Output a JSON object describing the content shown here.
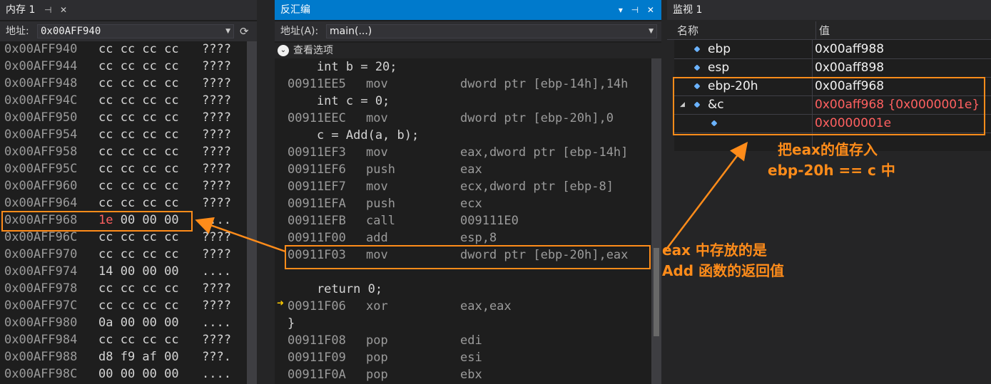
{
  "memory": {
    "title": "内存 1",
    "address_label": "地址:",
    "address_value": "0x00AFF940",
    "rows": [
      {
        "addr": "0x00AFF940",
        "bytes": "cc cc cc cc",
        "ascii": "????"
      },
      {
        "addr": "0x00AFF944",
        "bytes": "cc cc cc cc",
        "ascii": "????"
      },
      {
        "addr": "0x00AFF948",
        "bytes": "cc cc cc cc",
        "ascii": "????"
      },
      {
        "addr": "0x00AFF94C",
        "bytes": "cc cc cc cc",
        "ascii": "????"
      },
      {
        "addr": "0x00AFF950",
        "bytes": "cc cc cc cc",
        "ascii": "????"
      },
      {
        "addr": "0x00AFF954",
        "bytes": "cc cc cc cc",
        "ascii": "????"
      },
      {
        "addr": "0x00AFF958",
        "bytes": "cc cc cc cc",
        "ascii": "????"
      },
      {
        "addr": "0x00AFF95C",
        "bytes": "cc cc cc cc",
        "ascii": "????"
      },
      {
        "addr": "0x00AFF960",
        "bytes": "cc cc cc cc",
        "ascii": "????"
      },
      {
        "addr": "0x00AFF964",
        "bytes": "cc cc cc cc",
        "ascii": "????"
      },
      {
        "addr": "0x00AFF968",
        "bytes_hl": "1e",
        "bytes_rest": " 00 00 00",
        "ascii": "...."
      },
      {
        "addr": "0x00AFF96C",
        "bytes": "cc cc cc cc",
        "ascii": "????"
      },
      {
        "addr": "0x00AFF970",
        "bytes": "cc cc cc cc",
        "ascii": "????"
      },
      {
        "addr": "0x00AFF974",
        "bytes": "14 00 00 00",
        "ascii": "...."
      },
      {
        "addr": "0x00AFF978",
        "bytes": "cc cc cc cc",
        "ascii": "????"
      },
      {
        "addr": "0x00AFF97C",
        "bytes": "cc cc cc cc",
        "ascii": "????"
      },
      {
        "addr": "0x00AFF980",
        "bytes": "0a 00 00 00",
        "ascii": "...."
      },
      {
        "addr": "0x00AFF984",
        "bytes": "cc cc cc cc",
        "ascii": "????"
      },
      {
        "addr": "0x00AFF988",
        "bytes": "d8 f9 af 00",
        "ascii": "???."
      },
      {
        "addr": "0x00AFF98C",
        "bytes": "00 00 00 00",
        "ascii": "...."
      }
    ]
  },
  "disasm": {
    "title": "反汇编",
    "address_label": "地址(A):",
    "address_value": "main(...)",
    "options_label": "查看选项",
    "lines": [
      {
        "src": "    int b = 20;"
      },
      {
        "addr": "00911EE5",
        "op": "mov",
        "arg": "dword ptr [ebp-14h],14h"
      },
      {
        "src": "    int c = 0;"
      },
      {
        "addr": "00911EEC",
        "op": "mov",
        "arg": "dword ptr [ebp-20h],0"
      },
      {
        "src": "    c = Add(a, b);"
      },
      {
        "addr": "00911EF3",
        "op": "mov",
        "arg": "eax,dword ptr [ebp-14h]"
      },
      {
        "addr": "00911EF6",
        "op": "push",
        "arg": "eax"
      },
      {
        "addr": "00911EF7",
        "op": "mov",
        "arg": "ecx,dword ptr [ebp-8]"
      },
      {
        "addr": "00911EFA",
        "op": "push",
        "arg": "ecx"
      },
      {
        "addr": "00911EFB",
        "op": "call",
        "arg": "009111E0"
      },
      {
        "addr": "00911F00",
        "op": "add",
        "arg": "esp,8"
      },
      {
        "addr": "00911F03",
        "op": "mov",
        "arg": "dword ptr [ebp-20h],eax"
      },
      {
        "src": ""
      },
      {
        "src": "    return 0;"
      },
      {
        "addr": "00911F06",
        "op": "xor",
        "arg": "eax,eax"
      },
      {
        "src": "}"
      },
      {
        "addr": "00911F08",
        "op": "pop",
        "arg": "edi"
      },
      {
        "addr": "00911F09",
        "op": "pop",
        "arg": "esi"
      },
      {
        "addr": "00911F0A",
        "op": "pop",
        "arg": "ebx"
      }
    ]
  },
  "watch": {
    "title": "监视 1",
    "col_name": "名称",
    "col_value": "值",
    "rows": [
      {
        "name": "ebp",
        "value": "0x00aff988"
      },
      {
        "name": "esp",
        "value": "0x00aff898"
      },
      {
        "name": "ebp-20h",
        "value": "0x00aff968"
      },
      {
        "name": "&c",
        "value": "0x00aff968 {0x0000001e}"
      },
      {
        "name": "",
        "value": "0x0000001e"
      }
    ]
  },
  "annotations": {
    "eax_line1": "eax 中存放的是",
    "eax_line2": "Add 函数的返回值",
    "watch_line1": "把eax的值存入",
    "watch_line2": "ebp-20h == c 中"
  },
  "colors": {
    "accent": "#007acc",
    "annotation": "#ff8c1a",
    "changed_value": "#ff6060"
  }
}
